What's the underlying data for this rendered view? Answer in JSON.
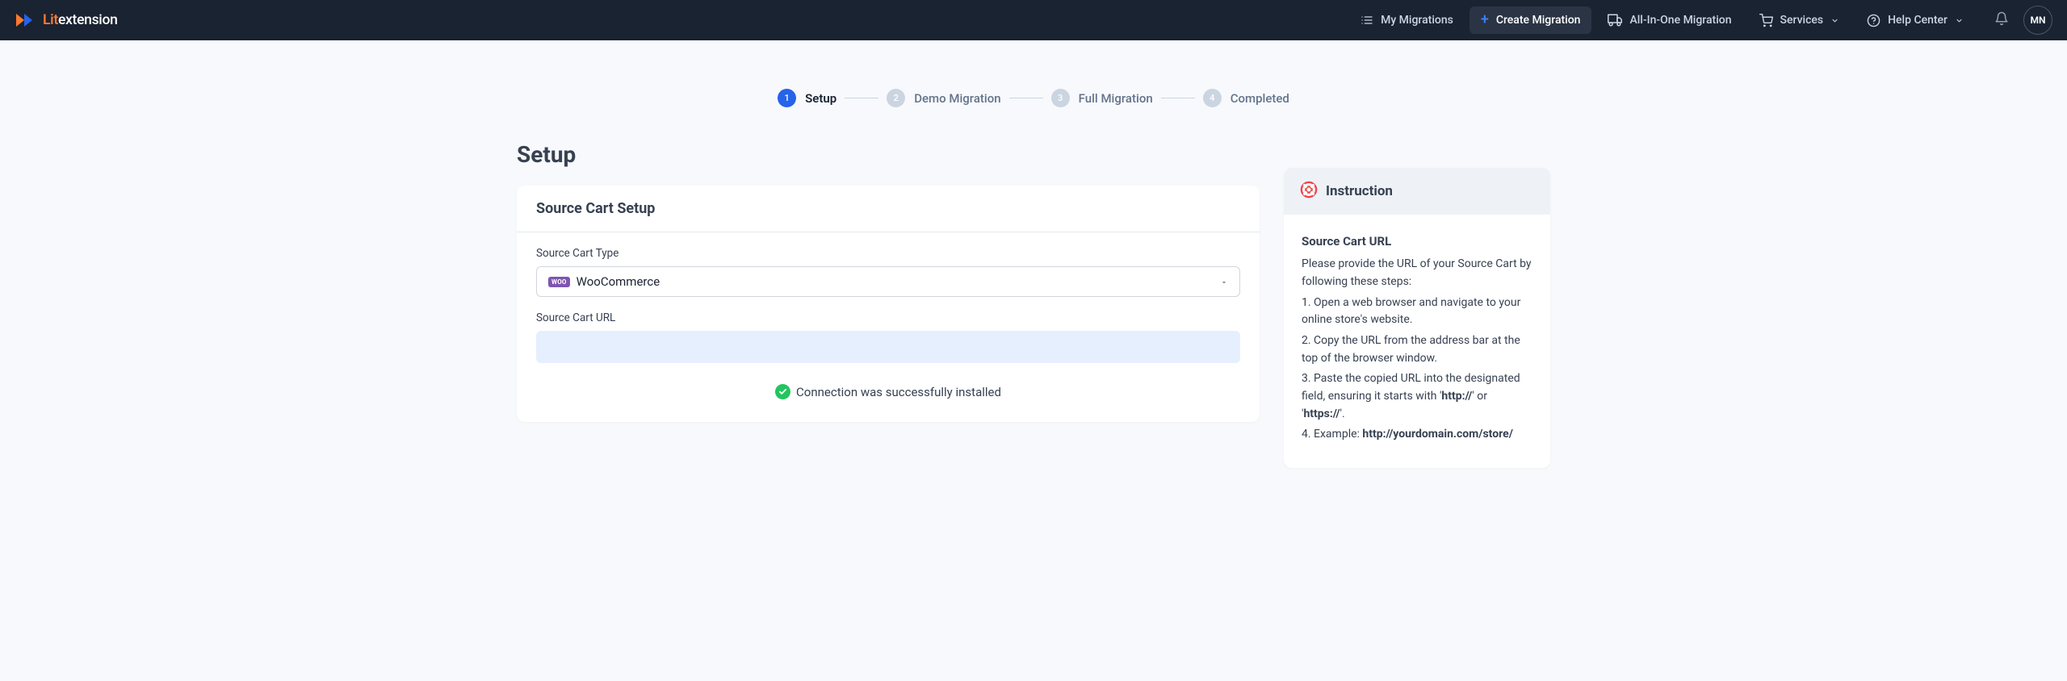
{
  "brand": {
    "lit": "Lit",
    "ext": "extension"
  },
  "nav": {
    "my_migrations": "My Migrations",
    "create_migration": "Create Migration",
    "all_in_one": "All-In-One Migration",
    "services": "Services",
    "help_center": "Help Center"
  },
  "avatar": "MN",
  "steps": [
    {
      "num": "1",
      "label": "Setup"
    },
    {
      "num": "2",
      "label": "Demo Migration"
    },
    {
      "num": "3",
      "label": "Full Migration"
    },
    {
      "num": "4",
      "label": "Completed"
    }
  ],
  "page_title": "Setup",
  "source_card": {
    "title": "Source Cart Setup",
    "type_label": "Source Cart Type",
    "type_value": "WooCommerce",
    "woo_badge": "WOO",
    "url_label": "Source Cart URL",
    "url_value": "",
    "status": "Connection was successfully installed"
  },
  "instruction": {
    "title": "Instruction",
    "heading": "Source Cart URL",
    "intro": "Please provide the URL of your Source Cart by following these steps:",
    "step1": "1. Open a web browser and navigate to your online store's website.",
    "step2": "2. Copy the URL from the address bar at the top of the browser window.",
    "step3a": "3. Paste the copied URL into the designated field, ensuring it starts with '",
    "http": "http://",
    "or": "' or '",
    "https": "https://",
    "step3b": "'.",
    "step4a": "4. Example: ",
    "example": "http://yourdomain.com/store/"
  }
}
